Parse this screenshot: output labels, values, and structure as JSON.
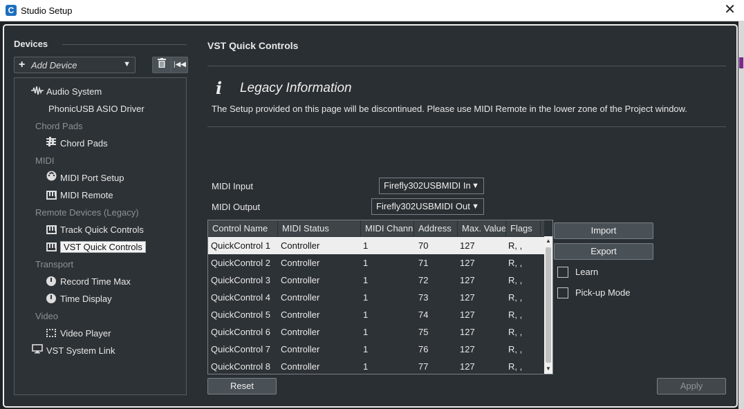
{
  "window": {
    "title": "Studio Setup"
  },
  "devices": {
    "heading": "Devices",
    "add_device_label": "Add Device",
    "tree": [
      {
        "label": "Audio System",
        "icon": "waveform-icon",
        "kind": "item"
      },
      {
        "label": "PhonicUSB ASIO Driver",
        "icon": "",
        "kind": "item"
      },
      {
        "label": "Chord Pads",
        "kind": "category"
      },
      {
        "label": "Chord Pads",
        "icon": "sliders-icon",
        "kind": "item"
      },
      {
        "label": "MIDI",
        "kind": "category"
      },
      {
        "label": "MIDI Port Setup",
        "icon": "midi-port-icon",
        "kind": "item"
      },
      {
        "label": "MIDI Remote",
        "icon": "keyboard-icon",
        "kind": "item"
      },
      {
        "label": "Remote Devices (Legacy)",
        "kind": "category"
      },
      {
        "label": "Track Quick Controls",
        "icon": "keyboard-icon",
        "kind": "item"
      },
      {
        "label": "VST Quick Controls",
        "icon": "keyboard-icon",
        "kind": "item",
        "selected": true
      },
      {
        "label": "Transport",
        "kind": "category"
      },
      {
        "label": "Record Time Max",
        "icon": "clock-icon",
        "kind": "item"
      },
      {
        "label": "Time Display",
        "icon": "clock-icon",
        "kind": "item"
      },
      {
        "label": "Video",
        "kind": "category"
      },
      {
        "label": "Video Player",
        "icon": "film-icon",
        "kind": "item"
      },
      {
        "label": "VST System Link",
        "icon": "monitor-icon",
        "kind": "item"
      }
    ]
  },
  "main": {
    "title": "VST Quick Controls",
    "legacy_title": "Legacy Information",
    "legacy_text": "The Setup provided on this page will be discontinued. Please use MIDI Remote in the lower zone of the Project window.",
    "midi_input_label": "MIDI Input",
    "midi_input_value": "Firefly302USBMIDI In",
    "midi_output_label": "MIDI Output",
    "midi_output_value": "Firefly302USBMIDI Out",
    "columns": [
      "Control Name",
      "MIDI Status",
      "MIDI Chann",
      "Address",
      "Max. Value",
      "Flags"
    ],
    "rows": [
      [
        "QuickControl 1",
        "Controller",
        "1",
        "70",
        "127",
        "R, ,"
      ],
      [
        "QuickControl 2",
        "Controller",
        "1",
        "71",
        "127",
        "R, ,"
      ],
      [
        "QuickControl 3",
        "Controller",
        "1",
        "72",
        "127",
        "R, ,"
      ],
      [
        "QuickControl 4",
        "Controller",
        "1",
        "73",
        "127",
        "R, ,"
      ],
      [
        "QuickControl 5",
        "Controller",
        "1",
        "74",
        "127",
        "R, ,"
      ],
      [
        "QuickControl 6",
        "Controller",
        "1",
        "75",
        "127",
        "R, ,"
      ],
      [
        "QuickControl 7",
        "Controller",
        "1",
        "76",
        "127",
        "R, ,"
      ],
      [
        "QuickControl 8",
        "Controller",
        "1",
        "77",
        "127",
        "R, ,"
      ]
    ],
    "selected_row": 0,
    "import_label": "Import",
    "export_label": "Export",
    "learn_label": "Learn",
    "pickup_label": "Pick-up Mode",
    "reset_label": "Reset",
    "apply_label": "Apply"
  }
}
